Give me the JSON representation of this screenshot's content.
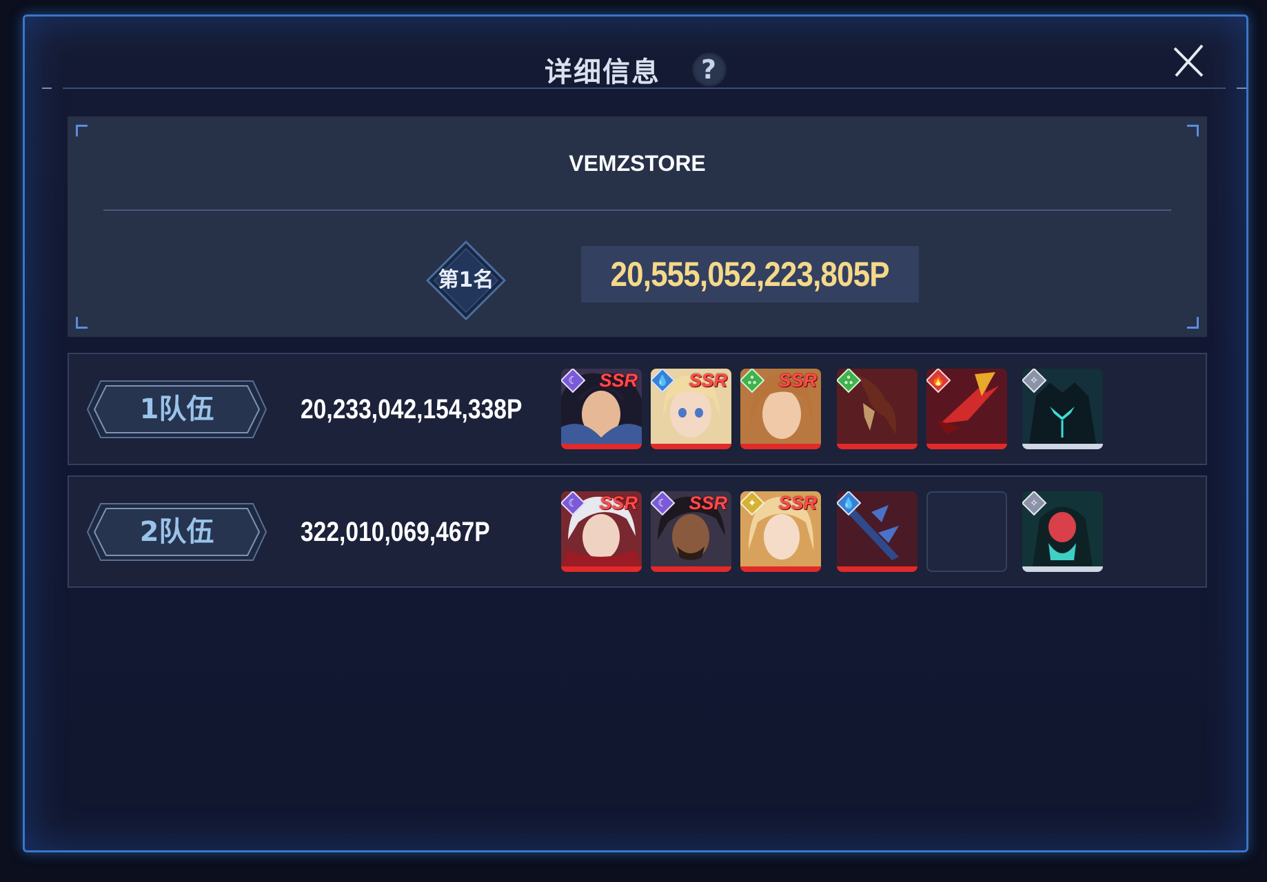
{
  "modal": {
    "title": "详细信息",
    "help_glyph": "?",
    "close_icon": "close-icon"
  },
  "summary": {
    "player_name": "VEMZSTORE",
    "rank_label": "第1名",
    "total_power": "20,555,052,223,805P"
  },
  "teams": [
    {
      "label": "1队伍",
      "power": "20,233,042,154,338P",
      "slots": [
        {
          "kind": "character",
          "rarity": "SSR",
          "element": "dark",
          "element_color": "#7a5ad8"
        },
        {
          "kind": "character",
          "rarity": "SSR",
          "element": "water",
          "element_color": "#3a7fd6"
        },
        {
          "kind": "character",
          "rarity": "SSR",
          "element": "wind",
          "element_color": "#3fb24a"
        },
        {
          "kind": "weapon",
          "element": "wind",
          "element_color": "#3fb24a"
        },
        {
          "kind": "weapon",
          "element": "fire",
          "element_color": "#d83a3a"
        },
        {
          "kind": "pet",
          "element": "neutral",
          "element_color": "#8b93a8"
        }
      ]
    },
    {
      "label": "2队伍",
      "power": "322,010,069,467P",
      "slots": [
        {
          "kind": "character",
          "rarity": "SSR",
          "element": "dark",
          "element_color": "#7a5ad8"
        },
        {
          "kind": "character",
          "rarity": "SSR",
          "element": "dark",
          "element_color": "#7a5ad8"
        },
        {
          "kind": "character",
          "rarity": "SSR",
          "element": "light",
          "element_color": "#d6b234"
        },
        {
          "kind": "weapon",
          "element": "water",
          "element_color": "#3a7fd6"
        },
        {
          "kind": "empty"
        },
        {
          "kind": "pet",
          "element": "neutral",
          "element_color": "#8b93a8"
        }
      ]
    }
  ],
  "colors": {
    "frame": "#3a76c9",
    "gold_text": "#f5d98a",
    "team_label": "#9ac3ea",
    "rarity_red": "#ff4b4b"
  }
}
